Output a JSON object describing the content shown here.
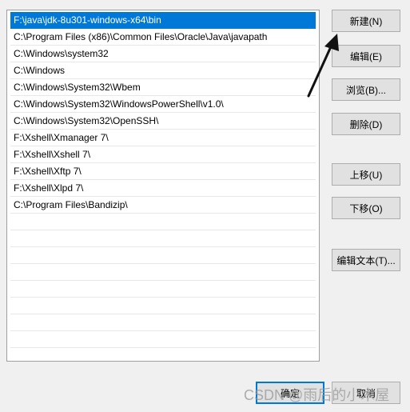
{
  "paths": [
    "F:\\java\\jdk-8u301-windows-x64\\bin",
    "C:\\Program Files (x86)\\Common Files\\Oracle\\Java\\javapath",
    "C:\\Windows\\system32",
    "C:\\Windows",
    "C:\\Windows\\System32\\Wbem",
    "C:\\Windows\\System32\\WindowsPowerShell\\v1.0\\",
    "C:\\Windows\\System32\\OpenSSH\\",
    "F:\\Xshell\\Xmanager 7\\",
    "F:\\Xshell\\Xshell 7\\",
    "F:\\Xshell\\Xftp 7\\",
    "F:\\Xshell\\Xlpd 7\\",
    "C:\\Program Files\\Bandizip\\"
  ],
  "buttons": {
    "new": "新建(N)",
    "edit": "编辑(E)",
    "browse": "浏览(B)...",
    "delete": "删除(D)",
    "move_up": "上移(U)",
    "move_down": "下移(O)",
    "edit_text": "编辑文本(T)...",
    "ok": "确定",
    "cancel": "取消"
  },
  "watermark": "CSDN @雨后的小木屋",
  "colors": {
    "selection": "#0078d7",
    "button_face": "#e1e1e1",
    "window_bg": "#f0f0f0"
  }
}
